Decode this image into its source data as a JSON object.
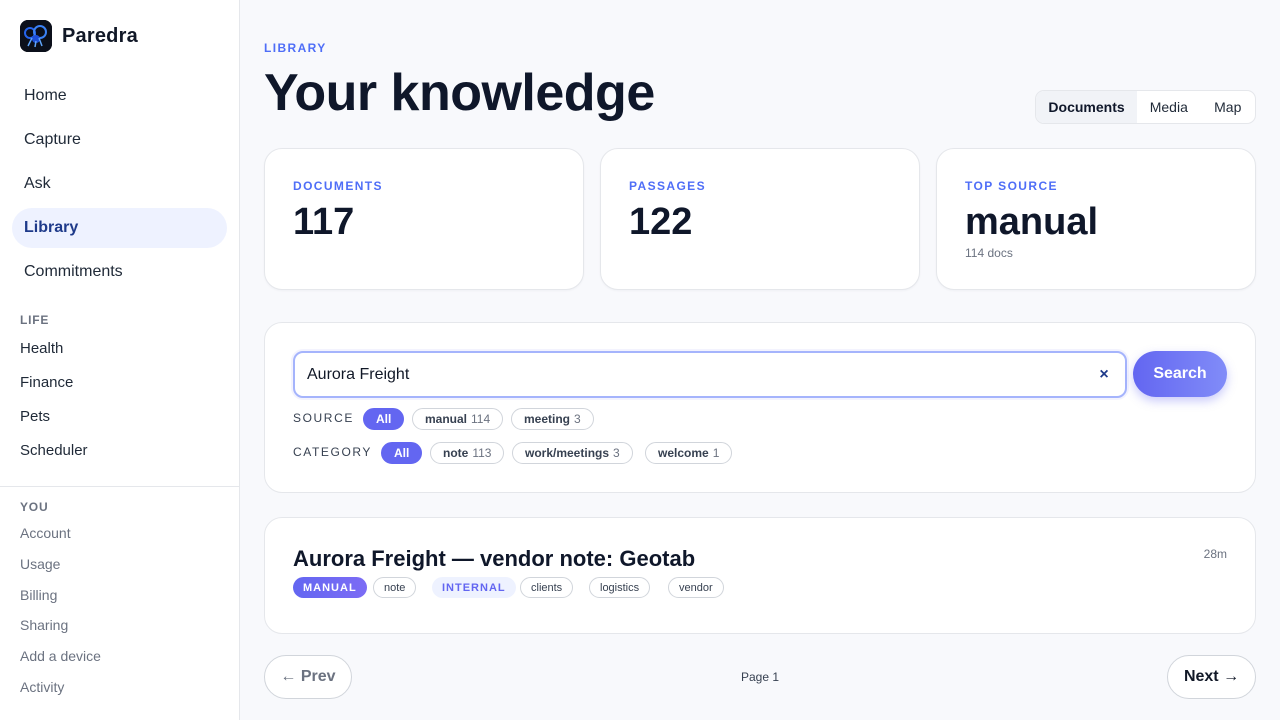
{
  "brand": {
    "name": "Paredra"
  },
  "sidebar": {
    "nav": [
      {
        "label": "Home"
      },
      {
        "label": "Capture"
      },
      {
        "label": "Ask"
      },
      {
        "label": "Library",
        "active": true
      },
      {
        "label": "Commitments"
      }
    ],
    "life_label": "LIFE",
    "life": [
      {
        "label": "Health"
      },
      {
        "label": "Finance"
      },
      {
        "label": "Pets"
      },
      {
        "label": "Scheduler"
      }
    ],
    "you_label": "YOU",
    "you": [
      {
        "label": "Account"
      },
      {
        "label": "Usage"
      },
      {
        "label": "Billing"
      },
      {
        "label": "Sharing"
      },
      {
        "label": "Add a device"
      },
      {
        "label": "Activity"
      }
    ]
  },
  "header": {
    "eyebrow": "LIBRARY",
    "title": "Your knowledge",
    "view_tabs": [
      {
        "label": "Documents",
        "active": true
      },
      {
        "label": "Media"
      },
      {
        "label": "Map"
      }
    ]
  },
  "stats": [
    {
      "label": "DOCUMENTS",
      "value": "117"
    },
    {
      "label": "PASSAGES",
      "value": "122"
    },
    {
      "label": "TOP SOURCE",
      "value": "manual",
      "sub": "114 docs"
    }
  ],
  "search": {
    "value": "Aurora Freight",
    "clear_icon": "×",
    "button_label": "Search",
    "source_label": "SOURCE",
    "source_chips": [
      {
        "label": "All",
        "count": "",
        "active": true
      },
      {
        "label": "manual",
        "count": "114"
      },
      {
        "label": "meeting",
        "count": "3"
      }
    ],
    "category_label": "CATEGORY",
    "category_chips": [
      {
        "label": "All",
        "count": "",
        "active": true
      },
      {
        "label": "note",
        "count": "113"
      },
      {
        "label": "work/meetings",
        "count": "3"
      },
      {
        "label": "welcome",
        "count": "1"
      }
    ]
  },
  "results": [
    {
      "title": "Aurora Freight — vendor note: Geotab",
      "time": "28m",
      "source_badge": "MANUAL",
      "category": "note",
      "visibility": "INTERNAL",
      "tags": [
        "clients",
        "logistics",
        "vendor"
      ]
    }
  ],
  "pager": {
    "prev_label": "← Prev",
    "page_label": "Page 1",
    "next_label": "Next →"
  },
  "colors": {
    "accent": "#6366f1",
    "eyebrow": "#4f6ef7",
    "active_nav_bg": "#eef2ff"
  }
}
